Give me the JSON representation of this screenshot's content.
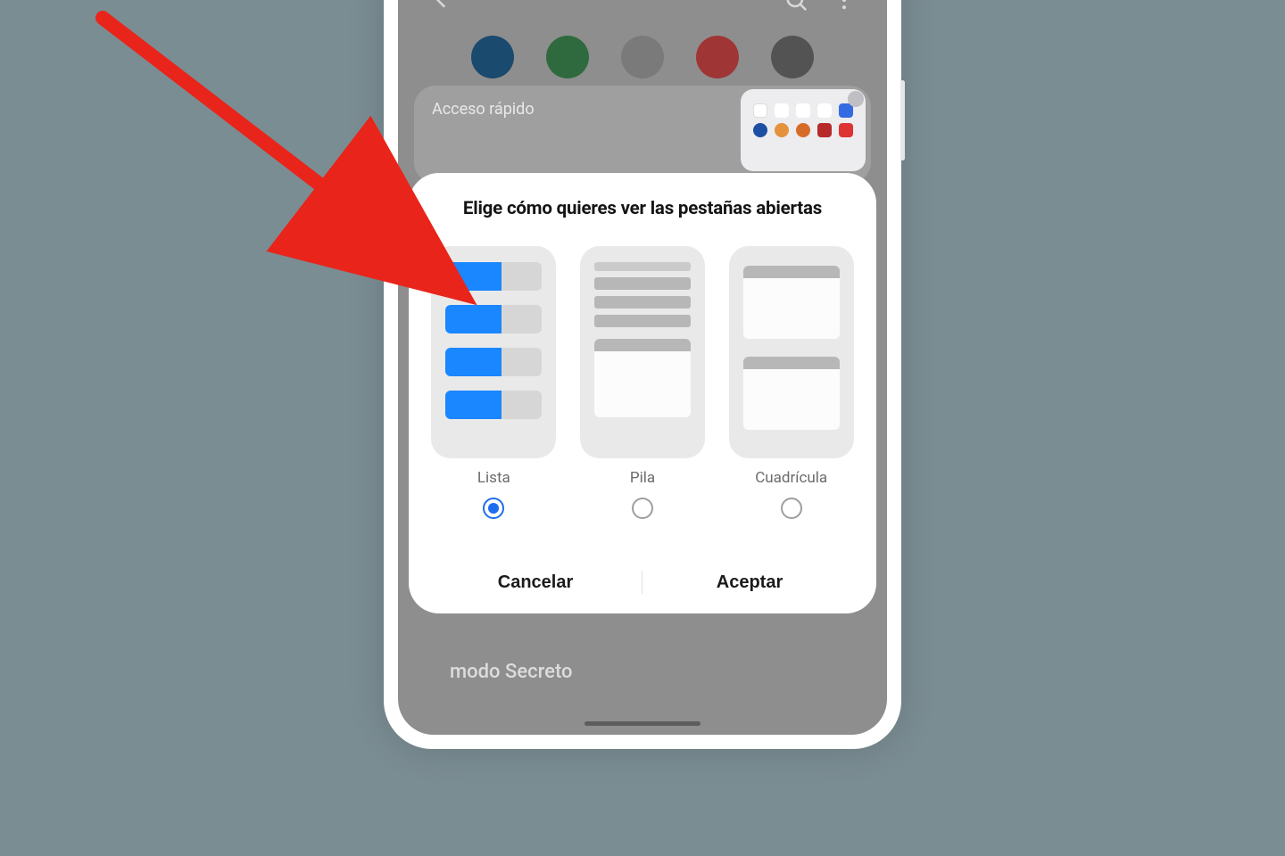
{
  "background_tab_label": "Acceso rápido",
  "bg_bottom_label": "modo Secreto",
  "sheet": {
    "title": "Elige cómo quieres ver las pestañas abiertas",
    "options": [
      {
        "key": "lista",
        "label": "Lista",
        "selected": true
      },
      {
        "key": "pila",
        "label": "Pila",
        "selected": false
      },
      {
        "key": "cuadricula",
        "label": "Cuadrícula",
        "selected": false
      }
    ],
    "cancel_label": "Cancelar",
    "accept_label": "Aceptar"
  }
}
